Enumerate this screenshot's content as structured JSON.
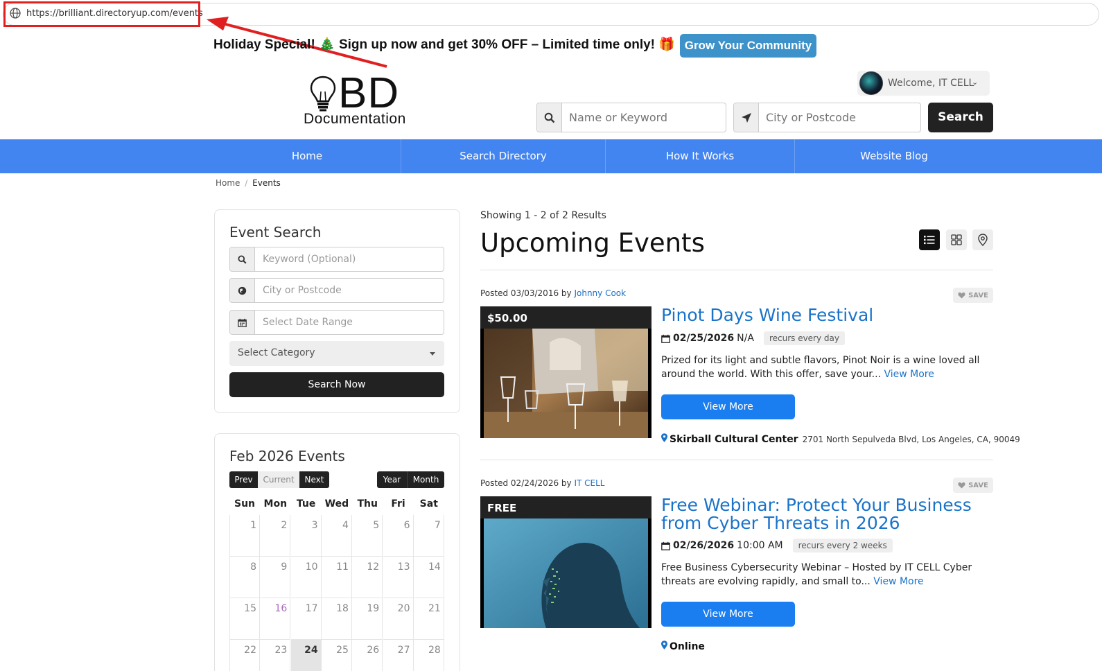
{
  "browser": {
    "url": "https://brilliant.directoryup.com/events"
  },
  "promo": {
    "text": "Holiday Special! 🎄 Sign up now and get 30% OFF – Limited time only! 🎁",
    "button": "Grow Your Community"
  },
  "logo": {
    "mark": "BD",
    "subtitle": "Documentation"
  },
  "user": {
    "welcome": "Welcome, IT CELL"
  },
  "header_search": {
    "keyword_placeholder": "Name or Keyword",
    "location_placeholder": "City or Postcode",
    "button": "Search"
  },
  "nav": {
    "items": [
      "Home",
      "Search Directory",
      "How It Works",
      "Website Blog"
    ]
  },
  "breadcrumb": {
    "home": "Home",
    "sep": "/",
    "current": "Events"
  },
  "event_search": {
    "title": "Event Search",
    "keyword_placeholder": "Keyword (Optional)",
    "location_placeholder": "City or Postcode",
    "date_placeholder": "Select Date Range",
    "category_placeholder": "Select Category",
    "button": "Search Now"
  },
  "calendar": {
    "title": "Feb 2026 Events",
    "prev": "Prev",
    "current": "Current",
    "next": "Next",
    "year": "Year",
    "month": "Month",
    "weekdays": [
      "Sun",
      "Mon",
      "Tue",
      "Wed",
      "Thu",
      "Fri",
      "Sat"
    ],
    "weeks": [
      [
        "1",
        "2",
        "3",
        "4",
        "5",
        "6",
        "7"
      ],
      [
        "8",
        "9",
        "10",
        "11",
        "12",
        "13",
        "14"
      ],
      [
        "15",
        "16",
        "17",
        "18",
        "19",
        "20",
        "21"
      ],
      [
        "22",
        "23",
        "24",
        "25",
        "26",
        "27",
        "28"
      ]
    ],
    "today": "24",
    "marked": "16"
  },
  "results": {
    "showing": "Showing 1 - 2 of 2 Results",
    "title": "Upcoming Events",
    "save_label": "SAVE",
    "events": [
      {
        "posted": "Posted 03/03/2016 by",
        "author": "Johnny Cook",
        "price": "$50.00",
        "title": "Pinot Days Wine Festival",
        "date": "02/25/2026",
        "time": "N/A",
        "recurs": "recurs every day",
        "description": "Prized for its light and subtle flavors, Pinot Noir is a wine loved all around the world. With this offer, save your...",
        "view_more_link": "View More",
        "button": "View More",
        "venue": "Skirball Cultural Center",
        "address": "2701 North Sepulveda Blvd, Los Angeles, CA, 90049"
      },
      {
        "posted": "Posted 02/24/2026 by",
        "author": "IT CELL",
        "price": "FREE",
        "title": "Free Webinar: Protect Your Business from Cyber Threats in 2026",
        "date": "02/26/2026",
        "time": "10:00 AM",
        "recurs": "recurs every 2 weeks",
        "description": "Free Business Cybersecurity Webinar – Hosted by IT CELL Cyber threats are evolving rapidly, and small to...",
        "view_more_link": "View More",
        "button": "View More",
        "venue": "Online",
        "address": ""
      }
    ]
  },
  "colors": {
    "nav": "#4385f0",
    "link": "#1a73c9",
    "button": "#1a7ef0",
    "promo_button": "#3d92c9",
    "highlight": "#e02020"
  }
}
